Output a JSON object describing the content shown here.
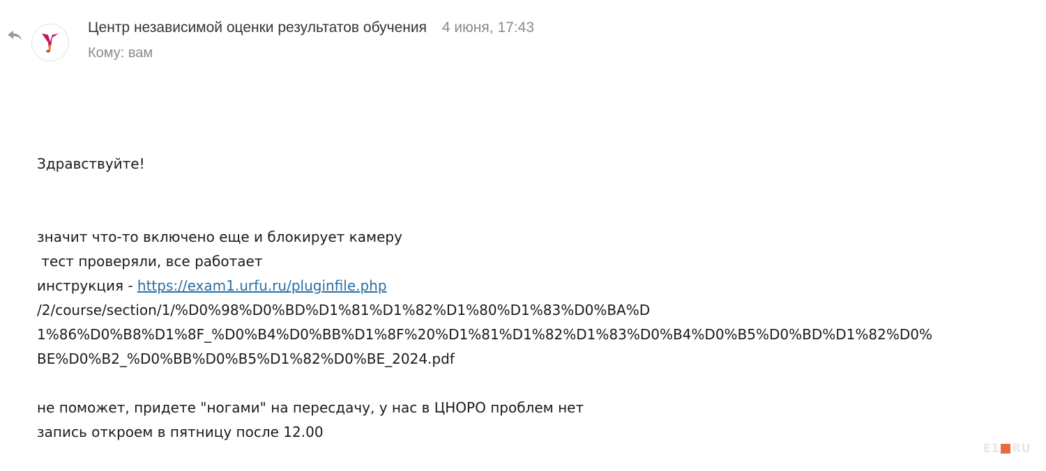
{
  "header": {
    "sender": "Центр независимой оценки результатов обучения",
    "date": "4 июня, 17:43",
    "recipient": "Кому: вам",
    "reply_icon": "reply-arrow-icon",
    "avatar_letter": "У"
  },
  "body": {
    "greeting": "Здравствуйте!",
    "line1": "значит что-то включено еще и блокирует камеру",
    "line2": " тест проверяли, все работает",
    "instruction_prefix": "инструкция - ",
    "instruction_link": "https://exam1.urfu.ru/pluginfile.php",
    "path1": "/2/course/section/1/%D0%98%D0%BD%D1%81%D1%82%D1%80%D1%83%D0%BA%D",
    "path2": "1%86%D0%B8%D1%8F_%D0%B4%D0%BB%D1%8F%20%D1%81%D1%82%D1%83%D0%B4%D0%B5%D0%BD%D1%82%D0%",
    "path3": "BE%D0%B2_%D0%BB%D0%B5%D1%82%D0%BE_2024.pdf",
    "line3": "не поможет, придете \"ногами\" на пересдачу, у нас в ЦНОРО проблем нет",
    "line4": "запись откроем в пятницу после 12.00"
  },
  "watermark": {
    "text_left": "E1",
    "text_right": "RU"
  },
  "colors": {
    "link": "#2a6ea3",
    "muted": "#8a8a8a",
    "avatar_accent": "#c2185b",
    "avatar_gold": "#f2a900",
    "watermark_accent": "#e94e1b"
  }
}
